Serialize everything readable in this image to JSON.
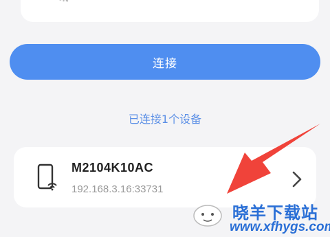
{
  "top_field": {
    "partial_text": "端"
  },
  "connect_button": {
    "label": "连接"
  },
  "status": {
    "text": "已连接1个设备"
  },
  "device": {
    "name": "M2104K10AC",
    "address": "192.168.3.16:33731",
    "icon": "phone-wifi-icon"
  },
  "chevron_icon": "chevron-right-icon",
  "colors": {
    "accent": "#4f8ef0",
    "status_text": "#5b8fe6",
    "arrow": "#f0433a"
  },
  "watermark": {
    "title": "晓羊下载站",
    "url": "www.xfhygs.com"
  }
}
